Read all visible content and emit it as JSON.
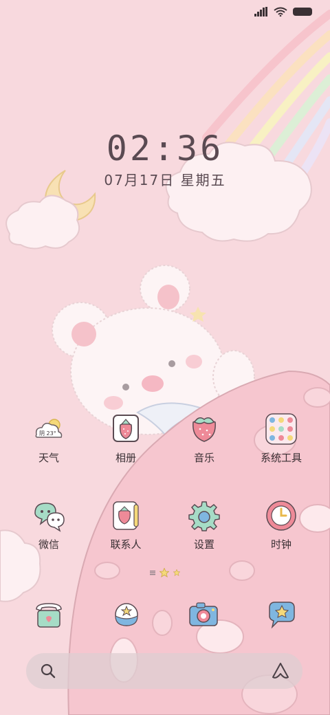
{
  "status_bar": {
    "icons": [
      "signal-icon",
      "wifi-icon",
      "battery-icon"
    ]
  },
  "clock": {
    "time": "02:36",
    "date": "07月17日 星期五"
  },
  "apps": [
    {
      "name": "weather",
      "label": "天气",
      "icon": "weather-icon",
      "temp": "阴 23°"
    },
    {
      "name": "gallery",
      "label": "相册",
      "icon": "strawberry-photo-icon"
    },
    {
      "name": "music",
      "label": "音乐",
      "icon": "strawberry-music-icon"
    },
    {
      "name": "system-tools",
      "label": "系统工具",
      "icon": "folder-icon"
    },
    {
      "name": "wechat",
      "label": "微信",
      "icon": "wechat-icon"
    },
    {
      "name": "contacts",
      "label": "联系人",
      "icon": "contacts-icon"
    },
    {
      "name": "settings",
      "label": "设置",
      "icon": "gear-icon"
    },
    {
      "name": "clock",
      "label": "时钟",
      "icon": "clock-icon"
    }
  ],
  "dock": [
    {
      "name": "phone",
      "icon": "telephone-icon"
    },
    {
      "name": "browser",
      "icon": "planet-icon"
    },
    {
      "name": "camera",
      "icon": "camera-icon"
    },
    {
      "name": "messages",
      "icon": "message-star-icon"
    }
  ],
  "colors": {
    "background": "#f8d9de",
    "text": "#3a3034",
    "clock_text": "#5a4a52",
    "accent_pink": "#ee8a98",
    "accent_green": "#a6dcc6",
    "accent_blue": "#7fb6e0",
    "accent_yellow": "#f5d97a"
  }
}
